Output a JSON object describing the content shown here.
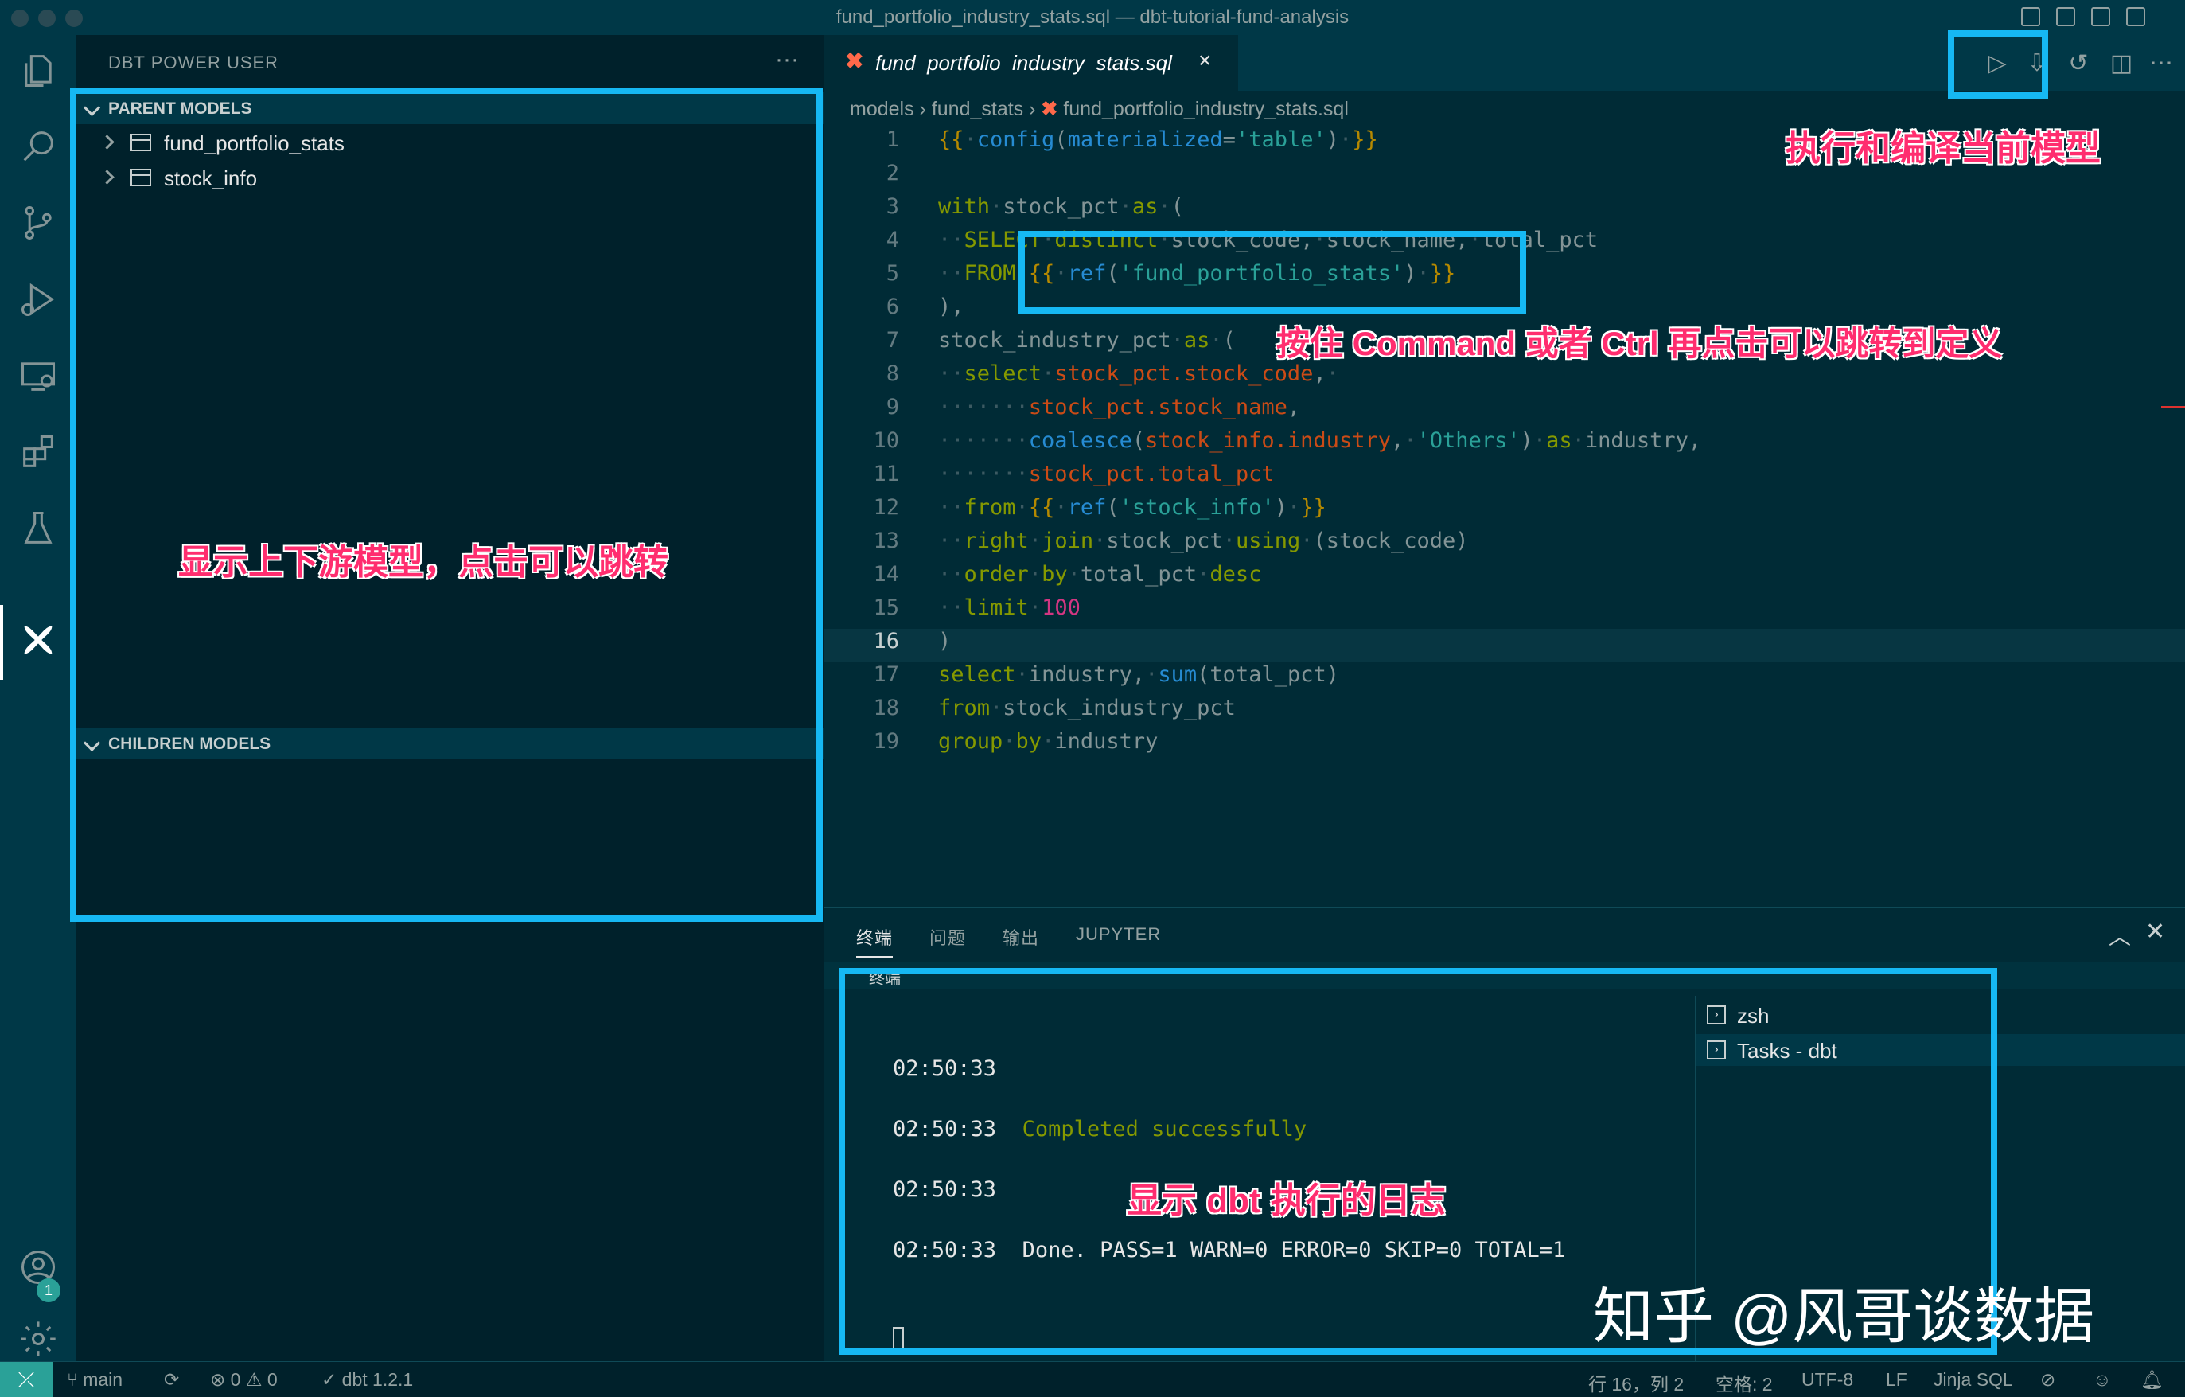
{
  "window": {
    "title": "fund_portfolio_industry_stats.sql — dbt-tutorial-fund-analysis"
  },
  "activity_bar": {
    "icons": [
      "files-icon",
      "search-icon",
      "source-control-icon",
      "run-debug-icon",
      "remote-explorer-icon",
      "extensions-icon",
      "testing-icon",
      "dbt-icon",
      "account-icon",
      "settings-gear-icon"
    ],
    "account_badge": "1"
  },
  "sidebar": {
    "title": "DBT POWER USER",
    "more": "···",
    "parent_section": "PARENT MODELS",
    "parent_models": [
      "fund_portfolio_stats",
      "stock_info"
    ],
    "children_section": "CHILDREN MODELS"
  },
  "editor": {
    "tab_label": "fund_portfolio_industry_stats.sql",
    "tab_close": "×",
    "breadcrumb": {
      "folder1": "models",
      "folder2": "fund_stats",
      "file": "fund_portfolio_industry_stats.sql"
    },
    "line_numbers": [
      "1",
      "2",
      "3",
      "4",
      "5",
      "6",
      "7",
      "8",
      "9",
      "10",
      "11",
      "12",
      "13",
      "14",
      "15",
      "16",
      "17",
      "18",
      "19"
    ]
  },
  "panel": {
    "tabs": [
      "终端",
      "问题",
      "输出",
      "JUPYTER"
    ],
    "terminal_header": "终端",
    "log": [
      {
        "time": "02:50:33",
        "msg": ""
      },
      {
        "time": "02:50:33",
        "msg": "Completed successfully"
      },
      {
        "time": "02:50:33",
        "msg": ""
      },
      {
        "time": "02:50:33",
        "msg": "Done. PASS=1 WARN=0 ERROR=0 SKIP=0 TOTAL=1"
      }
    ],
    "terminals": [
      "zsh",
      "Tasks - dbt"
    ]
  },
  "statusbar": {
    "branch": "main",
    "errors": "0",
    "warnings": "0",
    "dbt_version": "dbt 1.2.1",
    "cursor": "行 16，列 2",
    "spaces": "空格: 2",
    "encoding": "UTF-8",
    "eol": "LF",
    "language": "Jinja SQL"
  },
  "annotations": {
    "run_compile": "执行和编译当前模型",
    "jump_def": "按住 Command 或者 Ctrl 再点击可以跳转到定义",
    "lineage": "显示上下游模型，点击可以跳转",
    "log": "显示 dbt 执行的日志",
    "watermark": "知乎 @风哥谈数据"
  },
  "colors": {
    "accent": "#16b8f3",
    "annotation": "#ff2d6f",
    "keyword": "#859900",
    "function": "#268bd2",
    "string": "#2aa198"
  }
}
